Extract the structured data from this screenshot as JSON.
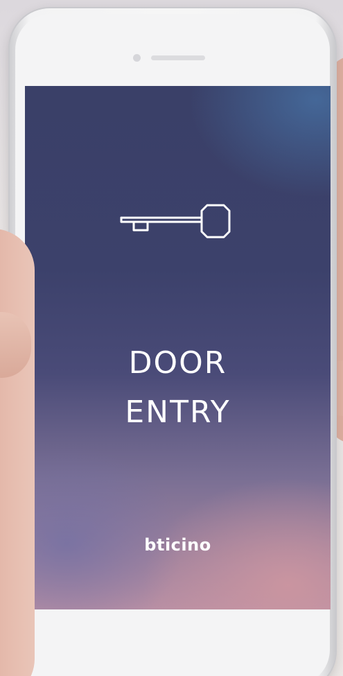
{
  "screen": {
    "icon": "key-icon",
    "title_line1": "DOOR",
    "title_line2": "ENTRY",
    "brand": "bticino"
  },
  "colors": {
    "background_top": "#3a4068",
    "background_bottom": "#b88fa4",
    "text": "#ffffff"
  }
}
